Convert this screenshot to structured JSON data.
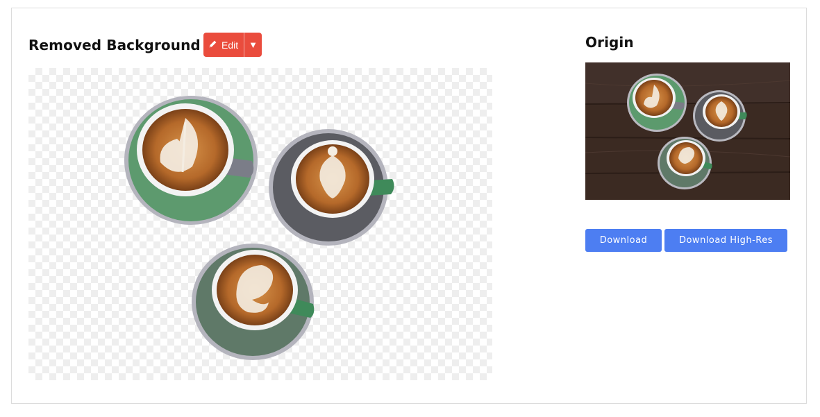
{
  "result": {
    "title": "Removed Background",
    "edit_label": "Edit",
    "edit_caret": "▼"
  },
  "origin": {
    "title": "Origin"
  },
  "actions": {
    "download_label": "Download",
    "download_hires_label": "Download High-Res"
  },
  "colors": {
    "edit_button": "#ea4c3d",
    "download_button": "#4d7ef2"
  },
  "icons": {
    "edit": "pencil-icon",
    "dropdown": "caret-down-icon"
  }
}
